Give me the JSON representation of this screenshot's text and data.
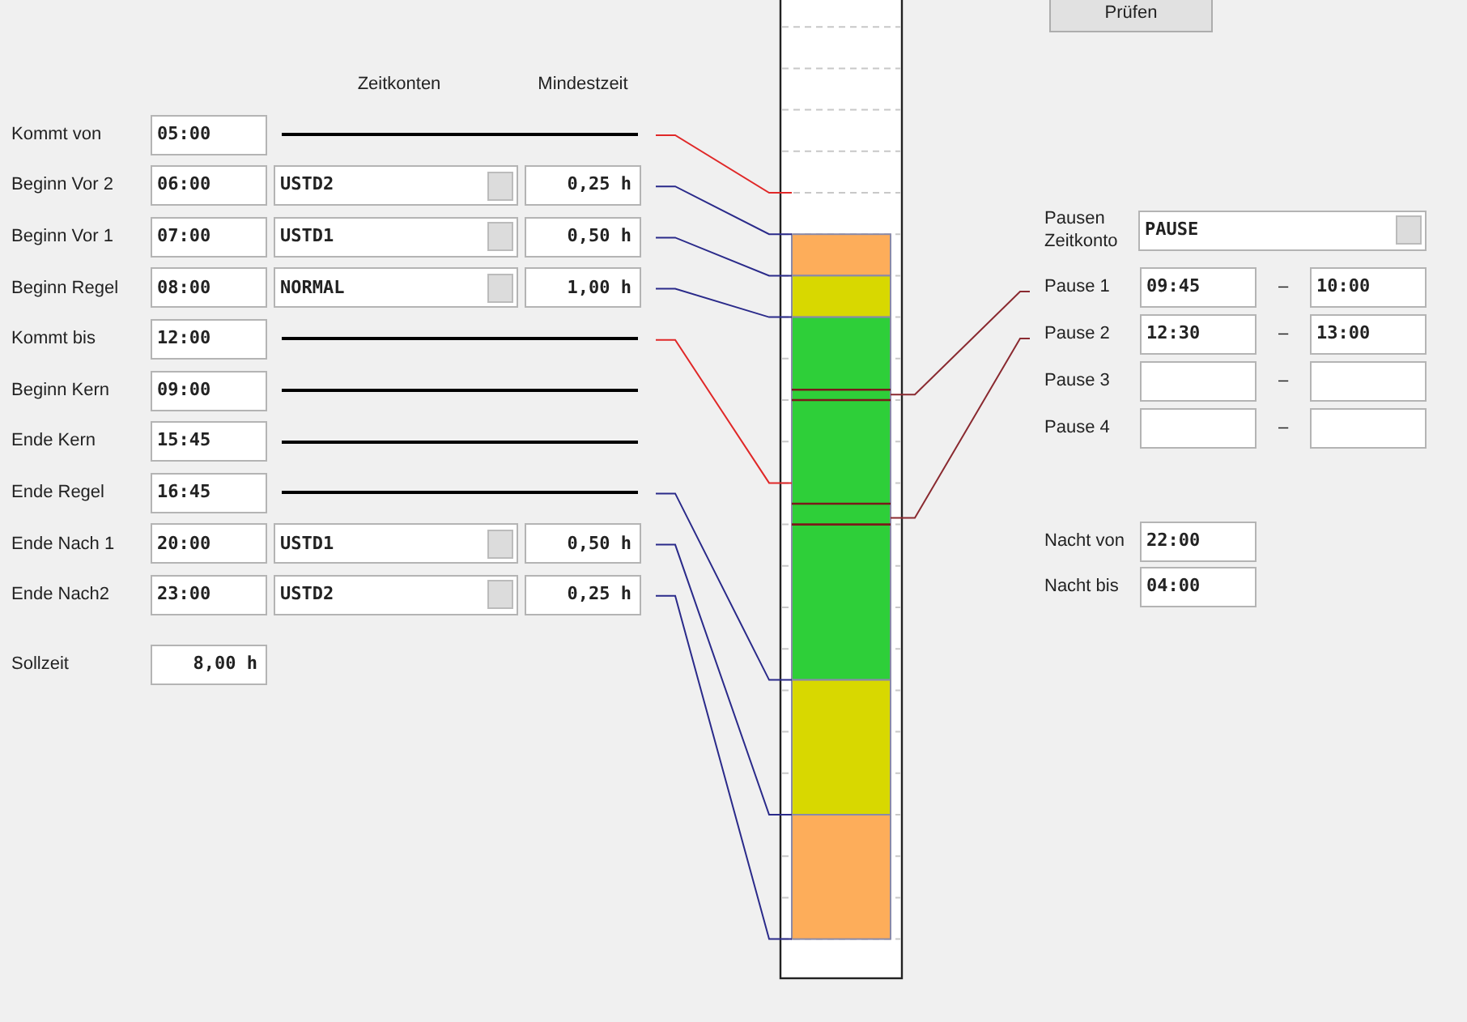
{
  "header": {
    "column_1": "Zeitkonten",
    "column_2": "Mindestzeit"
  },
  "rows": [
    {
      "kind": "line",
      "label": "Kommt von",
      "time": "05:00",
      "color": "#e02828"
    },
    {
      "kind": "account",
      "label": "Beginn Vor 2",
      "time": "06:00",
      "account": "USTD2",
      "minimum": "0,25 h",
      "color": "#2a2a8a"
    },
    {
      "kind": "account",
      "label": "Beginn Vor 1",
      "time": "07:00",
      "account": "USTD1",
      "minimum": "0,50 h",
      "color": "#2a2a8a"
    },
    {
      "kind": "account",
      "label": "Beginn Regel",
      "time": "08:00",
      "account": "NORMAL",
      "minimum": "1,00 h",
      "color": "#2a2a8a"
    },
    {
      "kind": "line",
      "label": "Kommt bis",
      "time": "12:00",
      "color": "#e02828"
    },
    {
      "kind": "line",
      "label": "Beginn Kern",
      "time": "09:00"
    },
    {
      "kind": "line",
      "label": "Ende Kern",
      "time": "15:45"
    },
    {
      "kind": "line",
      "label": "Ende Regel",
      "time": "16:45",
      "color": "#2a2a8a"
    },
    {
      "kind": "account",
      "label": "Ende Nach 1",
      "time": "20:00",
      "account": "USTD1",
      "minimum": "0,50 h",
      "color": "#2a2a8a"
    },
    {
      "kind": "account",
      "label": "Ende Nach2",
      "time": "23:00",
      "account": "USTD2",
      "minimum": "0,25 h",
      "color": "#2a2a8a"
    }
  ],
  "sollzeit": {
    "label": "Sollzeit",
    "value": "8,00 h"
  },
  "check_button": "Prüfen",
  "pause_account": {
    "label": "Pausen Zeitkonto",
    "value": "PAUSE"
  },
  "pauses": [
    {
      "label": "Pause 1",
      "from": "09:45",
      "separator": "–",
      "to": "10:00"
    },
    {
      "label": "Pause 2",
      "from": "12:30",
      "separator": "–",
      "to": "13:00"
    },
    {
      "label": "Pause 3",
      "separator": "–"
    },
    {
      "label": "Pause 4",
      "separator": "–"
    }
  ],
  "night": [
    {
      "label": "Nacht von",
      "value": "22:00"
    },
    {
      "label": "Nacht bis",
      "value": "04:00"
    }
  ]
}
